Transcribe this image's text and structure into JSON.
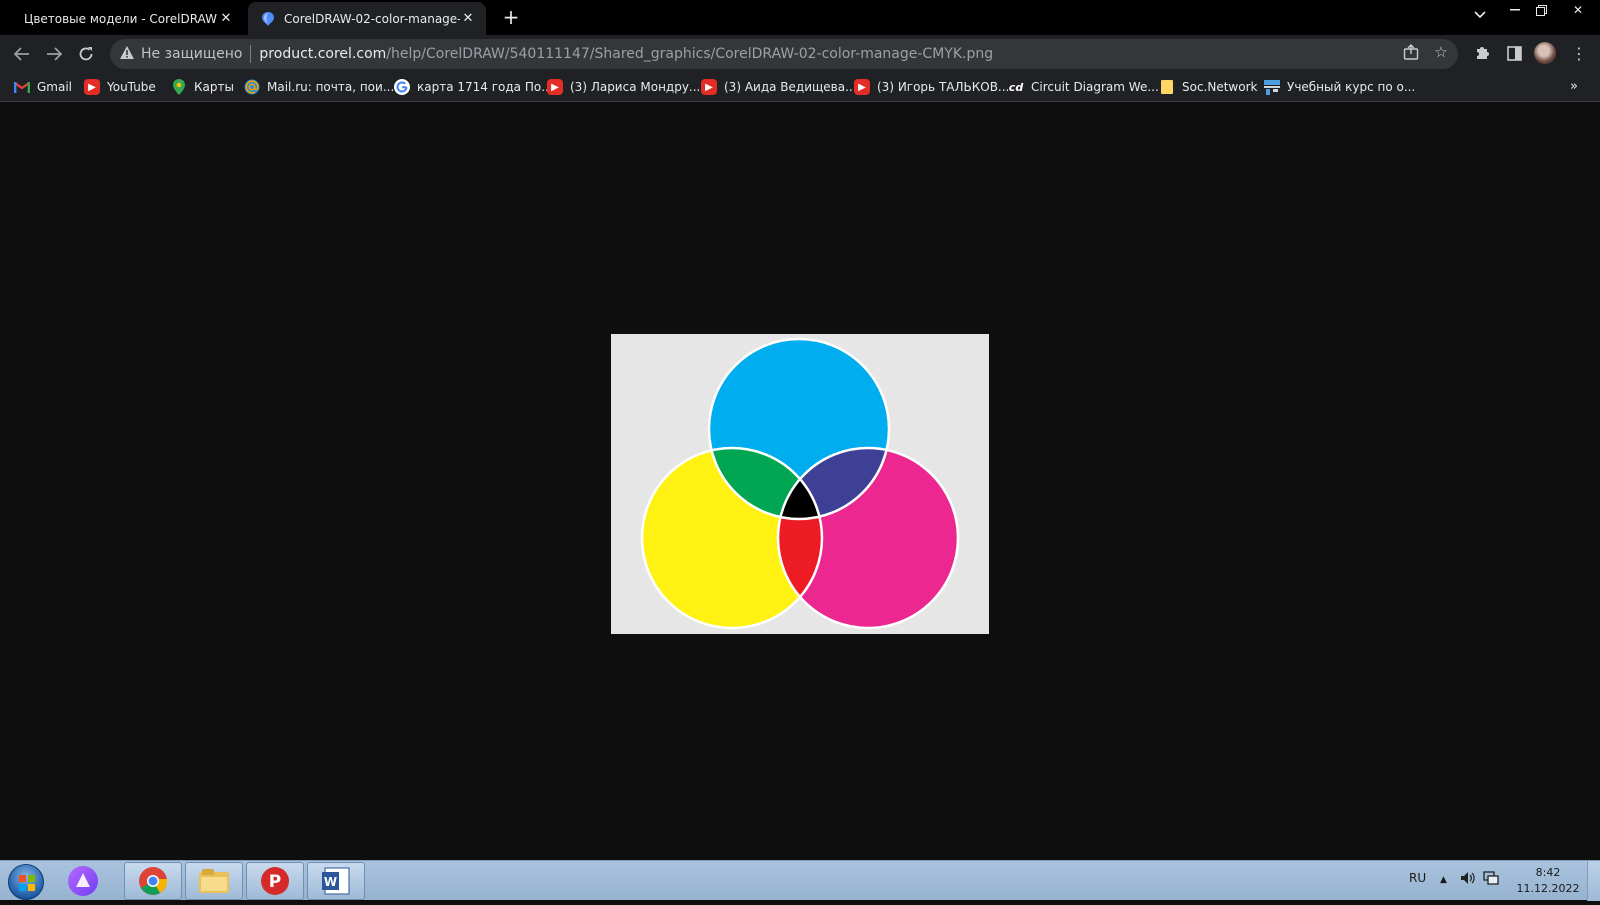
{
  "tabs": [
    {
      "title": "Цветовые модели - CorelDRAW",
      "active": false
    },
    {
      "title": "CorelDRAW-02-color-manage-CMYK.png",
      "active": true
    }
  ],
  "address": {
    "security": "Не защищено",
    "host": "product.corel.com",
    "path": "/help/CorelDRAW/540111147/Shared_graphics/CorelDRAW-02-color-manage-CMYK.png"
  },
  "bookmarks": [
    {
      "label": "Gmail",
      "icon": "gmail-icon"
    },
    {
      "label": "YouTube",
      "icon": "youtube-icon"
    },
    {
      "label": "Карты",
      "icon": "maps-pin-icon"
    },
    {
      "label": "Mail.ru: почта, пои...",
      "icon": "mailru-at-icon"
    },
    {
      "label": "карта 1714 года По...",
      "icon": "google-icon"
    },
    {
      "label": "(3) Лариса Мондру...",
      "icon": "youtube-icon"
    },
    {
      "label": "(3) Аида Ведищева...",
      "icon": "youtube-icon"
    },
    {
      "label": "(3) Игорь ТАЛЬКОВ...",
      "icon": "youtube-icon"
    },
    {
      "label": "Circuit Diagram We...",
      "icon": "circuit-diagram-icon"
    },
    {
      "label": "Soc.Network",
      "icon": "folder-icon"
    },
    {
      "label": "Учебный курс по о...",
      "icon": "course-icon"
    }
  ],
  "image": {
    "colors": {
      "cyan": "#00adef",
      "magenta": "#ec2890",
      "yellow": "#fff212",
      "green": "#00a651",
      "blue": "#3e4095",
      "red": "#ed1c24",
      "black": "#000000",
      "background": "#e6e6e6"
    }
  },
  "taskbar": {
    "language": "RU",
    "time": "8:42",
    "date": "11.12.2022"
  }
}
